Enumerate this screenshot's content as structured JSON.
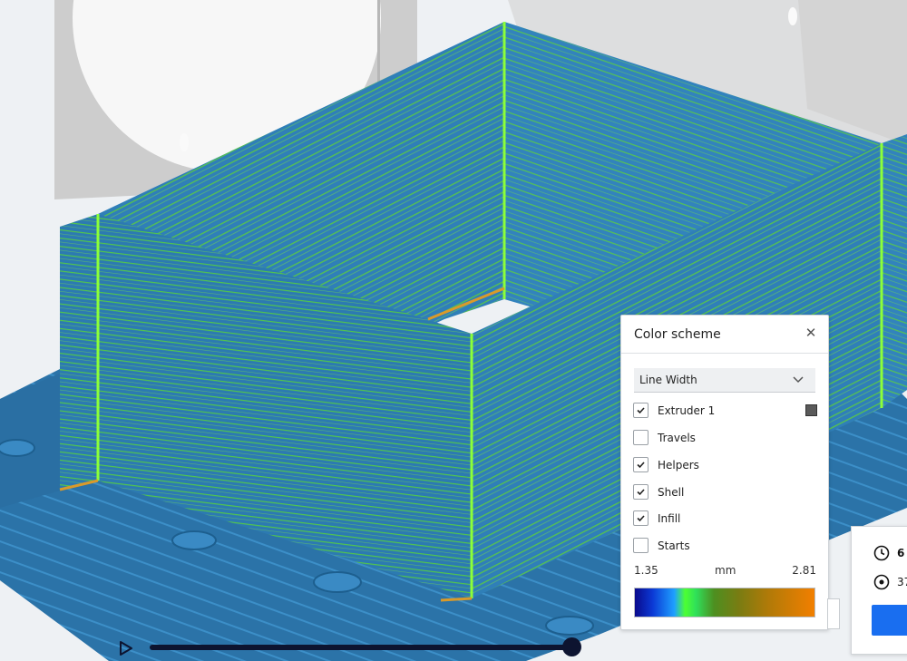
{
  "color_scheme_panel": {
    "title": "Color scheme",
    "scheme_select": {
      "value": "Line Width"
    },
    "options": [
      {
        "label": "Extruder 1",
        "checked": true,
        "swatch_color": "#5a5a5a"
      },
      {
        "label": "Travels",
        "checked": false
      },
      {
        "label": "Helpers",
        "checked": true
      },
      {
        "label": "Shell",
        "checked": true
      },
      {
        "label": "Infill",
        "checked": true
      },
      {
        "label": "Starts",
        "checked": false
      }
    ],
    "legend": {
      "min": "1.35",
      "unit": "mm",
      "max": "2.81"
    }
  },
  "print_info": {
    "time_fragment": "6",
    "material_fragment": "37"
  },
  "icons": [
    "close-icon",
    "chevron-down-icon",
    "checkmark-icon",
    "clock-icon",
    "material-icon",
    "play-icon"
  ],
  "colors": {
    "accent": "#196ef0",
    "slider": "#0d1430",
    "model_blue": "#2f7fb8",
    "extrusion_green": "#4dff32"
  }
}
